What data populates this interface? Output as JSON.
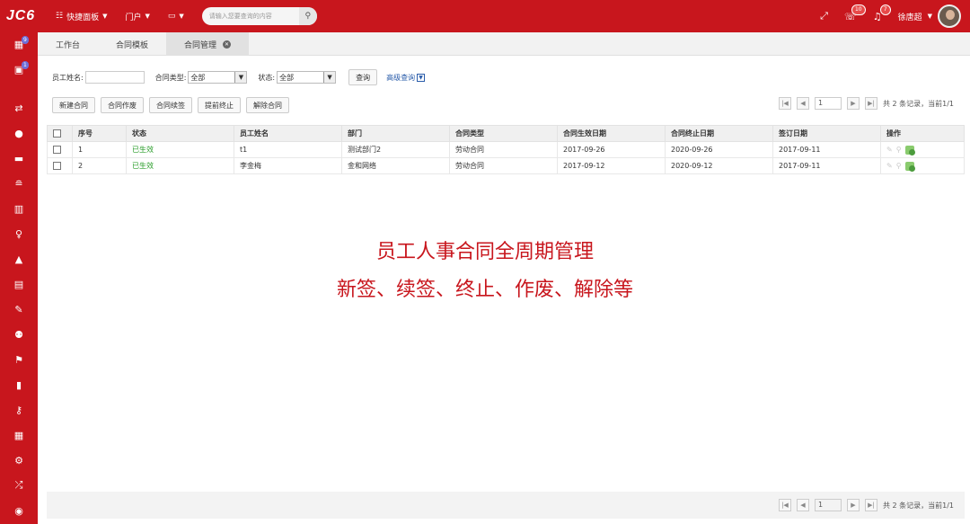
{
  "app": {
    "logo": "JC6"
  },
  "topbar": {
    "menu1": "快捷面板",
    "menu2": "门户",
    "menu3": "",
    "search_placeholder": "请输入您要查询的内容",
    "badge_msg": "10",
    "badge_notice": "7",
    "user_name": "徐唐超"
  },
  "sidebar": {
    "badge1": "9",
    "badge2": "1"
  },
  "tabs": [
    {
      "label": "工作台"
    },
    {
      "label": "合同模板"
    },
    {
      "label": "合同管理"
    }
  ],
  "filter": {
    "name_label": "员工姓名:",
    "type_label": "合同类型:",
    "type_value": "全部",
    "status_label": "状态:",
    "status_value": "全部",
    "query_button": "查询",
    "advanced_link": "高级查询"
  },
  "toolbar": {
    "new": "新建合同",
    "void": "合同作废",
    "renew": "合同续签",
    "terminate": "提前终止",
    "dissolve": "解除合同"
  },
  "pager": {
    "page": "1",
    "summary": "共 2 条记录，当前1/1"
  },
  "table": {
    "headers": [
      "序号",
      "状态",
      "员工姓名",
      "部门",
      "合同类型",
      "合同生效日期",
      "合同终止日期",
      "签订日期",
      "操作"
    ],
    "rows": [
      [
        "1",
        "已生效",
        "t1",
        "测试部门2",
        "劳动合同",
        "2017-09-26",
        "2020-09-26",
        "2017-09-11"
      ],
      [
        "2",
        "已生效",
        "李金梅",
        "金和网络",
        "劳动合同",
        "2017-09-12",
        "2020-09-12",
        "2017-09-11"
      ]
    ]
  },
  "caption": {
    "line1": "员工人事合同全周期管理",
    "line2": "新签、续签、终止、作废、解除等"
  },
  "colors": {
    "brand": "#c8161d",
    "active_status": "#2a9d2a"
  }
}
